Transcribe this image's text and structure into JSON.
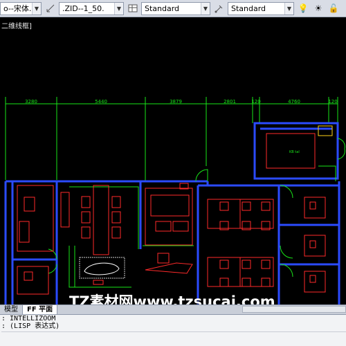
{
  "toolbar": {
    "font_value": "o--宋体.",
    "dim_value": ".ZID--1_50.",
    "text_style": "Standard",
    "table_style": "Standard"
  },
  "viewport_label": "二维线框]",
  "dimensions": [
    "3280",
    "5440",
    "3879",
    "2801",
    "120",
    "4760",
    "120"
  ],
  "room_label": "KB tal",
  "layout_tabs": [
    "模型",
    "FF 平面"
  ],
  "command_lines": [
    ": INTELLIZOOM",
    ": (LISP 表达式)"
  ],
  "watermark": "TZ素材网www.tzsucai.com",
  "colors": {
    "toolbar_bg": "#d9dde6",
    "canvas_bg": "#000000",
    "wall": "#2b4bff",
    "furniture": "#ff2a2a",
    "dimension": "#19e619"
  }
}
